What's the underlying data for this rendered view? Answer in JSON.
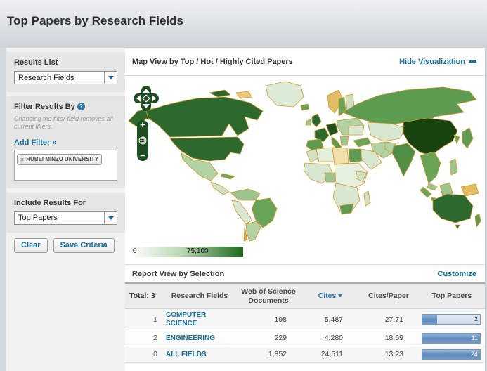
{
  "page": {
    "title": "Top Papers by Research Fields"
  },
  "sidebar": {
    "results_list": {
      "label": "Results List",
      "selected": "Research Fields"
    },
    "filter": {
      "label": "Filter Results By",
      "help_icon": "?",
      "note": "Changing the filter field removes all current filters.",
      "add_filter_label": "Add Filter »",
      "tag": {
        "remove": "×",
        "label": "HUBEI MINZU UNIVERSITY"
      }
    },
    "include_results": {
      "label": "Include Results For",
      "selected": "Top Papers"
    },
    "buttons": {
      "clear": "Clear",
      "save": "Save Criteria"
    }
  },
  "map_section": {
    "title": "Map View by Top / Hot / Highly Cited Papers",
    "hide_link": "Hide Visualization",
    "controls": {
      "zoom_in": "+",
      "zoom_out": "−"
    },
    "legend": {
      "min": "0",
      "max": "75,100"
    },
    "colors": {
      "no_data": "#f0e0ac",
      "low": "#d8e8d0",
      "mid": "#6aa457",
      "high": "#2d682d",
      "max": "#17430f",
      "border": "#cf992f"
    }
  },
  "report": {
    "title": "Report View by Selection",
    "customize_link": "Customize",
    "total_label": "Total: 3",
    "columns": {
      "field": "Research Fields",
      "docs": "Web of Science Documents",
      "cites": "Cites",
      "cites_per_paper": "Cites/Paper",
      "top_papers": "Top Papers"
    },
    "rows": [
      {
        "rank": "1",
        "field": "COMPUTER SCIENCE",
        "documents": "198",
        "cites": "5,487",
        "cites_per_paper": "27.71",
        "top_papers": "2",
        "bar_pct": 25
      },
      {
        "rank": "2",
        "field": "ENGINEERING",
        "documents": "229",
        "cites": "4,280",
        "cites_per_paper": "18.69",
        "top_papers": "11",
        "bar_pct": 100
      },
      {
        "rank": "0",
        "field": "ALL FIELDS",
        "documents": "1,852",
        "cites": "24,511",
        "cites_per_paper": "13.23",
        "top_papers": "24",
        "bar_pct": 100
      }
    ]
  },
  "chart_data": {
    "type": "table",
    "title": "Report View by Selection",
    "categories": [
      "COMPUTER SCIENCE",
      "ENGINEERING",
      "ALL FIELDS"
    ],
    "series": [
      {
        "name": "Web of Science Documents",
        "values": [
          198,
          229,
          1852
        ]
      },
      {
        "name": "Cites",
        "values": [
          5487,
          4280,
          24511
        ]
      },
      {
        "name": "Cites/Paper",
        "values": [
          27.71,
          18.69,
          13.23
        ]
      },
      {
        "name": "Top Papers",
        "values": [
          2,
          11,
          24
        ]
      }
    ],
    "map_legend_range": [
      0,
      75100
    ]
  }
}
